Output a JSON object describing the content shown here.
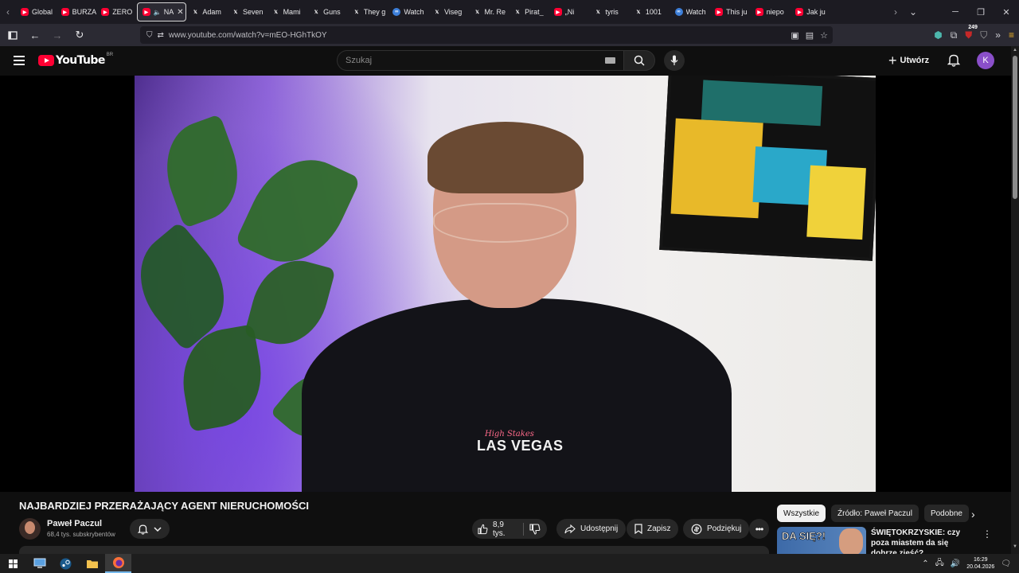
{
  "browser": {
    "tabs": [
      {
        "label": "Global",
        "icon": "youtube-favicon"
      },
      {
        "label": "BURZA",
        "icon": "youtube-favicon"
      },
      {
        "label": "ZERO",
        "icon": "youtube-favicon"
      },
      {
        "label": "NA",
        "icon": "youtube-favicon",
        "active": true
      },
      {
        "label": "Adam",
        "icon": "x-favicon"
      },
      {
        "label": "Seven",
        "icon": "x-favicon"
      },
      {
        "label": "Mami",
        "icon": "x-favicon"
      },
      {
        "label": "Guns",
        "icon": "x-favicon"
      },
      {
        "label": "They g",
        "icon": "x-favicon"
      },
      {
        "label": "Watch",
        "icon": "watch-favicon"
      },
      {
        "label": "Viseg",
        "icon": "x-favicon"
      },
      {
        "label": "Mr. Re",
        "icon": "x-favicon"
      },
      {
        "label": "Pirat_",
        "icon": "x-favicon"
      },
      {
        "label": "„Ni",
        "icon": "youtube-favicon"
      },
      {
        "label": "tyris",
        "icon": "x-favicon"
      },
      {
        "label": "1001",
        "icon": "x-favicon"
      },
      {
        "label": "Watch",
        "icon": "watch-favicon"
      },
      {
        "label": "This ju",
        "icon": "youtube-favicon"
      },
      {
        "label": "niepo",
        "icon": "youtube-favicon"
      },
      {
        "label": "Jak ju",
        "icon": "youtube-favicon"
      }
    ],
    "url": "www.youtube.com/watch?v=mEO-HGhTkOY",
    "extension_badge": "249"
  },
  "youtube": {
    "logo_text": "YouTube",
    "country_code": "BR",
    "search_placeholder": "Szukaj",
    "create_label": "Utwórz",
    "avatar_letter": "K",
    "avatar_color": "#8a4fc9"
  },
  "video": {
    "shirt_script": "High Stakes",
    "shirt_text": "LAS VEGAS",
    "title": "NAJBARDZIEJ PRZERAŻAJĄCY AGENT NIERUCHOMOŚCI",
    "channel_name": "Paweł Paczul",
    "subscribers": "68,4 tys. subskrybentów",
    "likes": "8,9 tys.",
    "share_label": "Udostępnij",
    "save_label": "Zapisz",
    "thanks_label": "Podziękuj"
  },
  "sidebar": {
    "chips": [
      "Wszystkie",
      "Źródło: Paweł Paczul",
      "Podobne"
    ],
    "recommendation": {
      "thumb_text": "DA SIĘ?!",
      "title": "ŚWIĘTOKRZYSKIE: czy poza miastem da się dobrze zjeść?"
    }
  },
  "taskbar": {
    "time": "16:29",
    "date": "20.04.2026"
  },
  "colors": {
    "youtube_red": "#ff0033",
    "background": "#0f0f0f",
    "pill": "#272727"
  }
}
